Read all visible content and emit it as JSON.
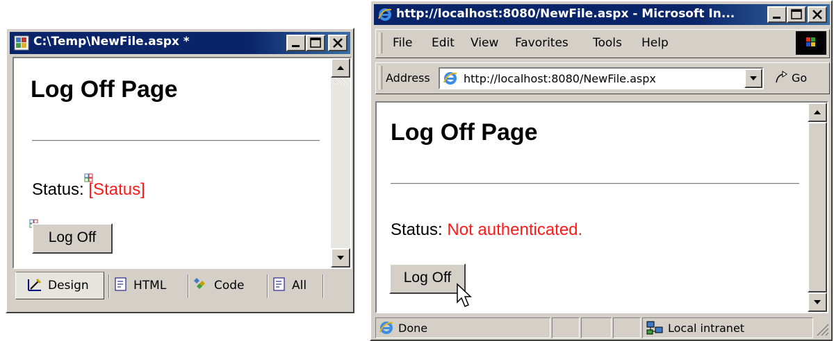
{
  "designer": {
    "title": "C:\\Temp\\NewFile.aspx *",
    "heading": "Log Off Page",
    "status_label": "Status:",
    "status_placeholder": "[Status]",
    "button_label": "Log Off",
    "tabs": [
      {
        "label": "Design",
        "icon": "design-icon"
      },
      {
        "label": "HTML",
        "icon": "html-icon"
      },
      {
        "label": "Code",
        "icon": "code-icon"
      },
      {
        "label": "All",
        "icon": "all-icon"
      }
    ]
  },
  "browser": {
    "title": "http://localhost:8080/NewFile.aspx - Microsoft In...",
    "menu": [
      "File",
      "Edit",
      "View",
      "Favorites",
      "Tools",
      "Help"
    ],
    "address_label": "Address",
    "address_value": "http://localhost:8080/NewFile.aspx",
    "go_label": "Go",
    "heading": "Log Off Page",
    "status_label": "Status:",
    "status_value": "Not authenticated.",
    "button_label": "Log Off",
    "statusbar_text": "Done",
    "zone_text": "Local intranet"
  },
  "colors": {
    "titlebar": "#0a246a",
    "chrome": "#d4d0c8",
    "status_red": "#ff1a1a"
  }
}
